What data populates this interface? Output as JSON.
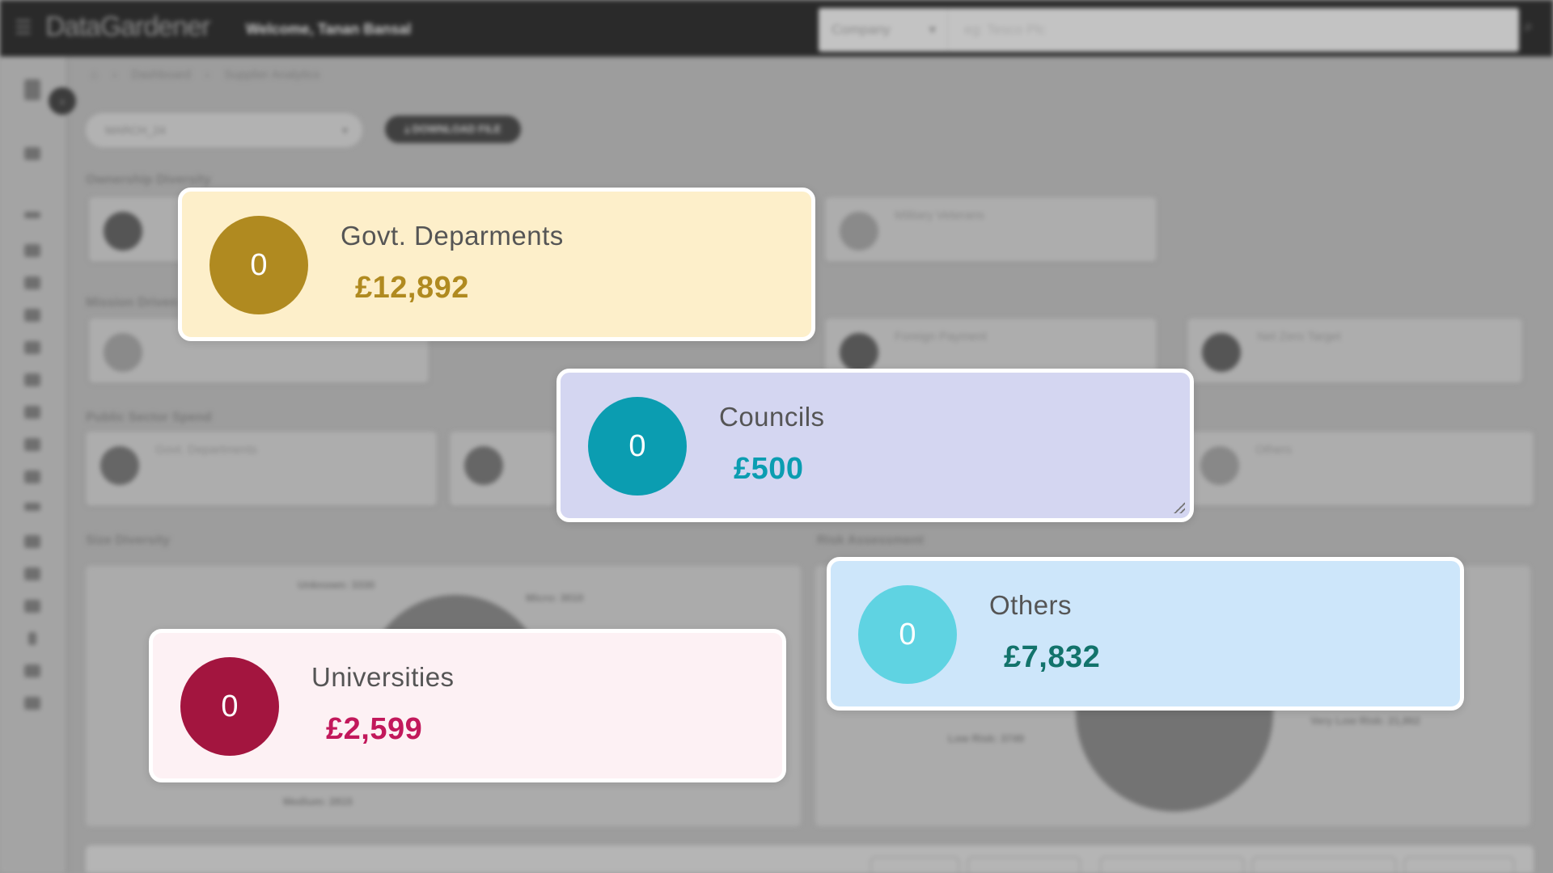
{
  "header": {
    "brand": "DataGardener",
    "welcome": "Welcome, Tanan Bansal",
    "search_type": "Company",
    "search_placeholder": "eg: Tesco Plc"
  },
  "breadcrumb": [
    "Dashboard",
    "Supplier Analytics"
  ],
  "year_select": "MARCH_24",
  "download_label": "DOWNLOAD FILE",
  "sections": {
    "ownership": "Ownership Diversity",
    "mission": "Mission Driven",
    "public_sector": "Public Sector Spend",
    "size": "Size Diversity",
    "risk": "Risk Assessment"
  },
  "background_cards": {
    "military": "Military Veterans",
    "foreign": "Foreign Payment",
    "netzero": "Net Zero Target",
    "govt": "Govt. Departments",
    "councils": "Councils",
    "others": "Others"
  },
  "chart_labels": {
    "unknown": "Unknown: 3330",
    "micro": "Micro: 3010",
    "medium": "Medium: 2815",
    "low_risk": "Low Risk: 3749",
    "very_low_risk": "Very Low Risk: 21,862"
  },
  "cards": {
    "govt": {
      "count": "0",
      "title": "Govt. Deparments",
      "amount": "£12,892",
      "bg": "#fdefca",
      "circle": "#b08a20",
      "amount_color": "#b08a20"
    },
    "councils": {
      "count": "0",
      "title": "Councils",
      "amount": "£500",
      "bg": "#d4d6f1",
      "circle": "#0b9db1",
      "amount_color": "#0b9db1"
    },
    "universities": {
      "count": "0",
      "title": "Universities",
      "amount": "£2,599",
      "bg": "#fdf1f4",
      "circle": "#a3153f",
      "amount_color": "#c2185b"
    },
    "others": {
      "count": "0",
      "title": "Others",
      "amount": "£7,832",
      "bg": "#cde6fa",
      "circle": "#5fd3e2",
      "amount_color": "#12736b"
    }
  }
}
